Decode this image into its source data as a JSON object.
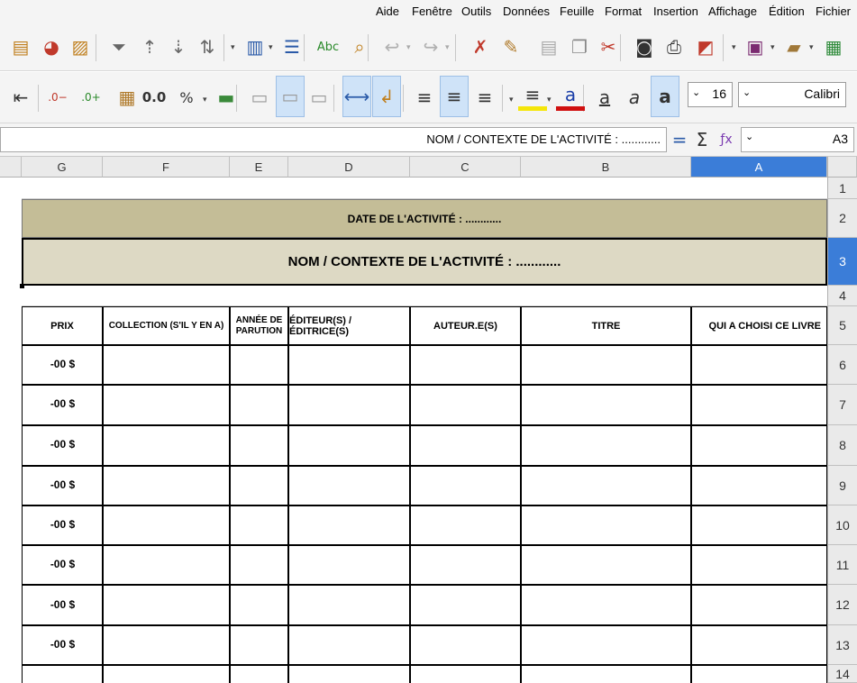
{
  "menu": [
    "Fichier",
    "Édition",
    "Affichage",
    "Insertion",
    "Format",
    "Feuille",
    "Données",
    "Outils",
    "Fenêtre",
    "Aide"
  ],
  "toolbar1": {
    "icons": [
      "new-sheet-icon",
      "open-icon",
      "save-icon",
      "export-pdf-icon",
      "print-icon",
      "print-preview-icon",
      "cut-icon",
      "copy-icon",
      "paste-icon",
      "clone-format-icon",
      "clear-format-icon",
      "undo-icon",
      "redo-icon",
      "find-replace-icon",
      "spellcheck-icon",
      "row-icon",
      "column-icon",
      "sort-icon",
      "sort-ascending-icon",
      "sort-descending-icon",
      "autofilter-icon",
      "image-icon",
      "chart-icon",
      "pivot-table-icon"
    ]
  },
  "toolbar2": {
    "font_name": "Calibri",
    "font_size": "16",
    "icons": [
      "bold-icon",
      "italic-icon",
      "underline-icon",
      "font-color-icon",
      "highlight-icon",
      "align-left-icon",
      "align-center-icon",
      "align-right-icon",
      "wrap-text-icon",
      "merge-center-icon",
      "align-top-icon",
      "align-middle-icon",
      "align-bottom-icon",
      "currency-icon",
      "percent-icon",
      "number-format-icon",
      "date-icon",
      "add-decimal-icon",
      "remove-decimal-icon",
      "indent-icon"
    ],
    "number_format_label": "0.0",
    "percent_label": "%"
  },
  "formula_bar": {
    "cell_ref": "A3",
    "content": "NOM / CONTEXTE DE L'ACTIVITÉ : ............"
  },
  "columns": [
    "A",
    "B",
    "C",
    "D",
    "E",
    "F",
    "G"
  ],
  "rows": [
    "1",
    "2",
    "3",
    "4",
    "5",
    "6",
    "7",
    "8",
    "9",
    "10",
    "11",
    "12",
    "13",
    "14"
  ],
  "sheet": {
    "date_banner": "DATE DE L'ACTIVITÉ : ............",
    "name_banner": "NOM / CONTEXTE DE L'ACTIVITÉ : ............",
    "headers": [
      "QUI A CHOISI CE LIVRE",
      "TITRE",
      "AUTEUR.E(S)",
      "ÉDITEUR(S) / ÉDITRICE(S)",
      "ANNÉE DE PARUTION",
      "COLLECTION (S'IL Y EN A)",
      "PRIX"
    ],
    "prices": [
      "-00 $",
      "-00 $",
      "-00 $",
      "-00 $",
      "-00 $",
      "-00 $",
      "-00 $",
      "-00 $"
    ]
  },
  "colors": {
    "date_banner_bg": "#c4bd97",
    "name_banner_bg": "#ddd9c4",
    "selection_blue": "#3b7dd8"
  }
}
